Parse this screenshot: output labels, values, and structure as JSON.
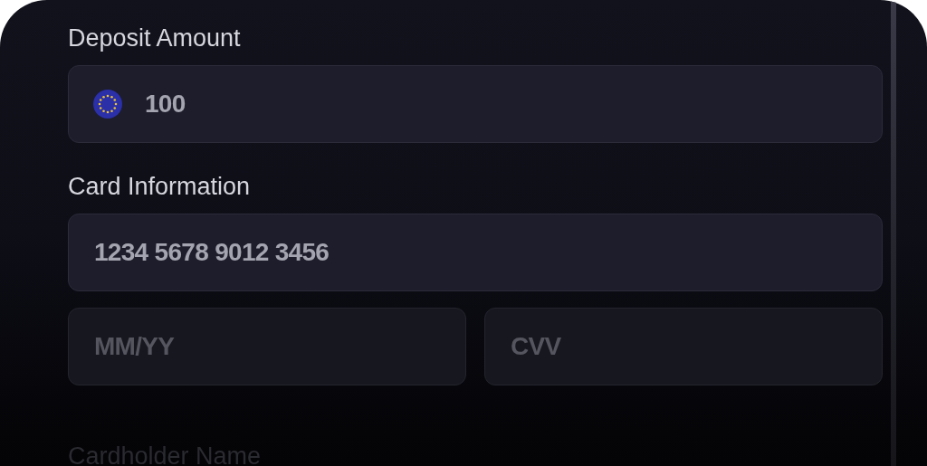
{
  "sections": [
    {
      "label": "Deposit Amount",
      "fields": [
        {
          "kind": "currency",
          "value": "100"
        }
      ]
    },
    {
      "label": "Card Information",
      "fields": [
        {
          "kind": "text",
          "value": "1234 5678 9012 3456"
        }
      ]
    },
    {
      "fields": [
        {
          "kind": "text",
          "placeholder": "MM/YY"
        },
        {
          "kind": "text",
          "placeholder": "CVV"
        }
      ]
    },
    {
      "label": "Cardholder Name",
      "faded": true
    }
  ]
}
